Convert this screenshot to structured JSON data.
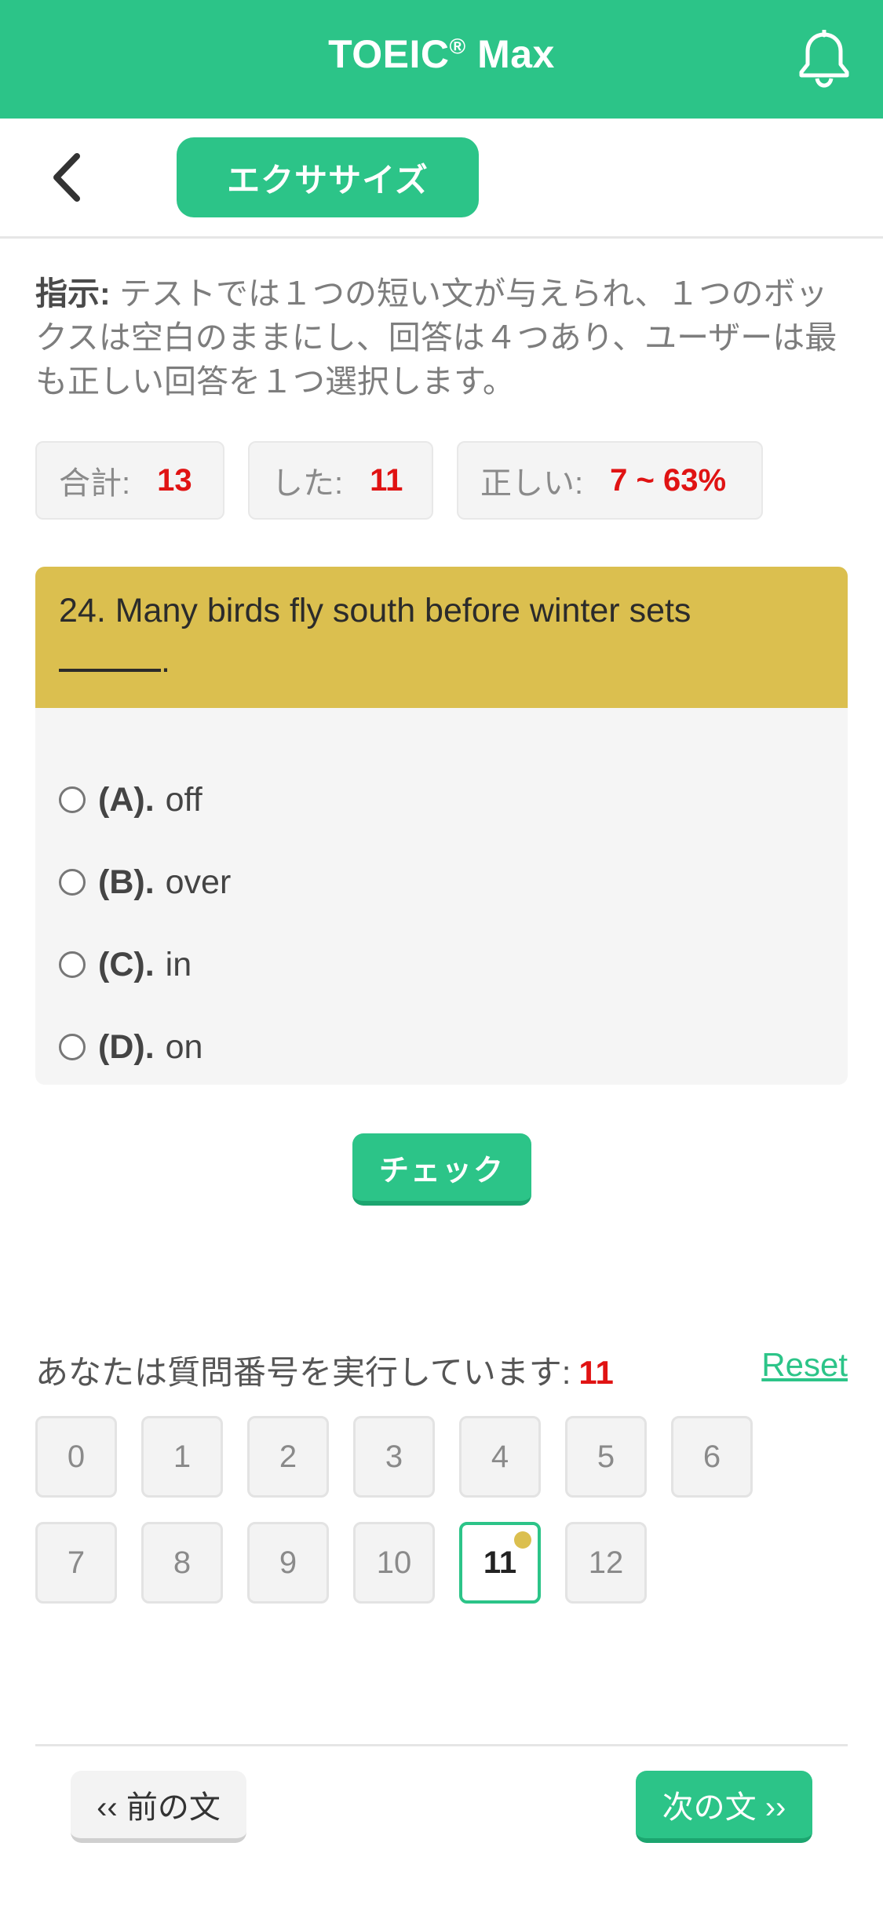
{
  "header": {
    "title": "TOEIC",
    "title_reg": "®",
    "title_suffix": " Max"
  },
  "subheader": {
    "tab_label": "エクササイズ"
  },
  "instruction": {
    "label": "指示:",
    "text": " テストでは１つの短い文が与えられ、１つのボックスは空白のままにし、回答は４つあり、ユーザーは最も正しい回答を１つ選択します。"
  },
  "stats": {
    "total_label": "合計:",
    "total_value": "13",
    "done_label": "した:",
    "done_value": "11",
    "correct_label": "正しい:",
    "correct_value": "7 ~ 63%"
  },
  "question": {
    "text": "24. Many birds fly south before winter sets",
    "tail": ".",
    "options": [
      {
        "key": "(A).",
        "text": "off"
      },
      {
        "key": "(B).",
        "text": "over"
      },
      {
        "key": "(C).",
        "text": "in"
      },
      {
        "key": "(D).",
        "text": "on"
      }
    ]
  },
  "check_label": "チェック",
  "progress": {
    "label": "あなたは質問番号を実行しています:",
    "current": "11",
    "reset_label": "Reset",
    "numbers": [
      "0",
      "1",
      "2",
      "3",
      "4",
      "5",
      "6",
      "7",
      "8",
      "9",
      "10",
      "11",
      "12"
    ],
    "active_index": 11
  },
  "nav": {
    "prev_label": "‹‹ 前の文",
    "next_label": "次の文 ››"
  },
  "colors": {
    "brand": "#2cc488",
    "question_bg": "#dbbf4f",
    "highlight": "#e01313"
  },
  "icons": {
    "bell": "bell-icon",
    "back": "chevron-left-icon"
  }
}
